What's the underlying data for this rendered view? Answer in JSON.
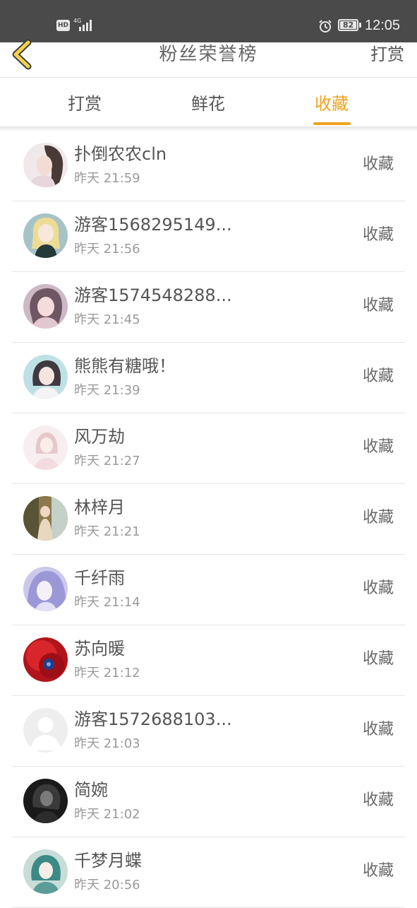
{
  "status_bar": {
    "hd": "HD",
    "network": "4G",
    "battery": "82",
    "time": "12:05",
    "icons": [
      "signal-icon",
      "alarm-icon",
      "battery-icon"
    ]
  },
  "nav": {
    "title": "粉丝荣誉榜",
    "right_label": "打赏",
    "back_icon": "chevron-left-icon"
  },
  "tabs": [
    {
      "label": "打赏",
      "active": false
    },
    {
      "label": "鲜花",
      "active": false
    },
    {
      "label": "收藏",
      "active": true
    }
  ],
  "colors": {
    "accent": "#f0a31e",
    "status_bar": "#4a4a4a",
    "back_icon": "#f2d34a"
  },
  "fans": [
    {
      "name": "扑倒农农cln",
      "time": "昨天 21:59",
      "action": "收藏"
    },
    {
      "name": "游客1568295149...",
      "time": "昨天 21:56",
      "action": "收藏"
    },
    {
      "name": "游客1574548288...",
      "time": "昨天 21:45",
      "action": "收藏"
    },
    {
      "name": "熊熊有糖哦！",
      "time": "昨天 21:39",
      "action": "收藏"
    },
    {
      "name": "风万劫",
      "time": "昨天 21:27",
      "action": "收藏"
    },
    {
      "name": "林梓月",
      "time": "昨天 21:21",
      "action": "收藏"
    },
    {
      "name": "千纤雨",
      "time": "昨天 21:14",
      "action": "收藏"
    },
    {
      "name": "苏向暖",
      "time": "昨天 21:12",
      "action": "收藏"
    },
    {
      "name": "游客1572688103...",
      "time": "昨天 21:03",
      "action": "收藏"
    },
    {
      "name": "简婉",
      "time": "昨天 21:02",
      "action": "收藏"
    },
    {
      "name": "千梦月蝶",
      "time": "昨天 20:56",
      "action": "收藏"
    }
  ]
}
